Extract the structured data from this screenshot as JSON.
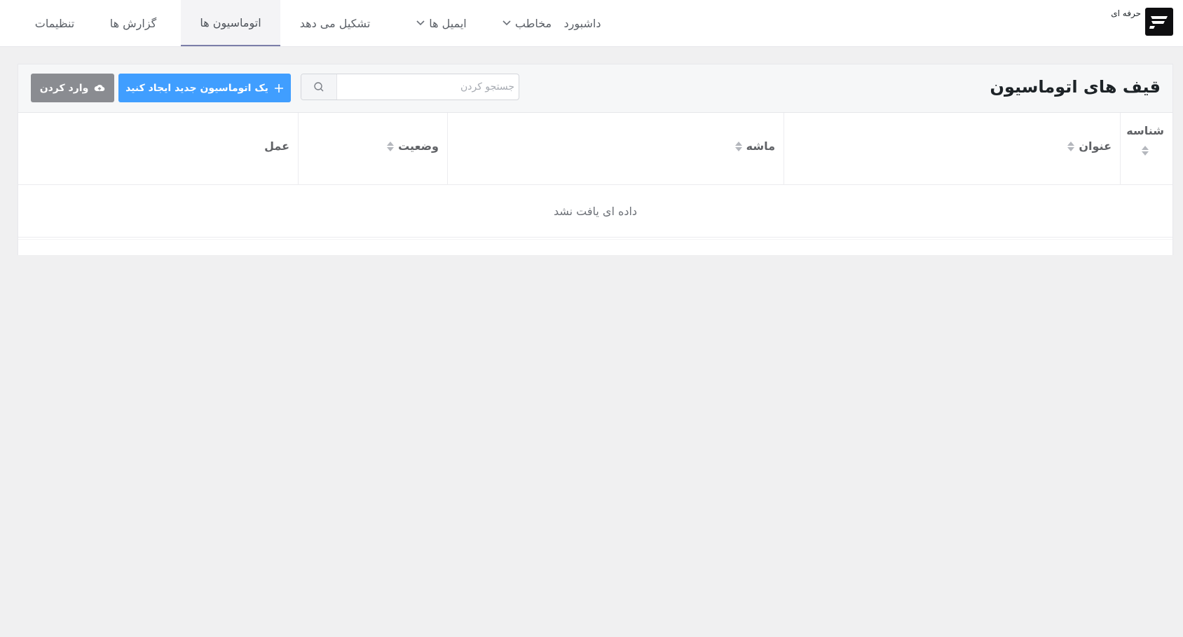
{
  "brand": {
    "name": "حرفه ای"
  },
  "nav": {
    "items": [
      {
        "label": "داشبورد"
      },
      {
        "label": "مخاطب"
      },
      {
        "label": "ایمیل ها"
      },
      {
        "label": "تشکیل می دهد"
      },
      {
        "label": "اتوماسیون ها"
      },
      {
        "label": "گزارش ها"
      },
      {
        "label": "تنظیمات"
      }
    ],
    "active": "اتوماسیون ها"
  },
  "page": {
    "title": "قیف های اتوماسیون"
  },
  "search": {
    "placeholder": "جستجو کردن",
    "value": ""
  },
  "buttons": {
    "create": "یک اتوماسیون جدید ایجاد کنید",
    "import": "وارد کردن"
  },
  "table": {
    "columns": [
      "شناسه",
      "عنوان",
      "ماشه",
      "وضعیت",
      "عمل"
    ],
    "empty_text": "داده ای یافت نشد"
  },
  "colors": {
    "primary": "#409eff",
    "secondary": "#8a8c91",
    "active_tab_underline": "#7b7ea8"
  },
  "icons": {
    "logo": "logo-mark",
    "search": "search-icon",
    "create": "plus-icon",
    "import": "upload-cloud-icon",
    "dropdown": "chevron-down-icon",
    "sort": "sort-icon"
  }
}
